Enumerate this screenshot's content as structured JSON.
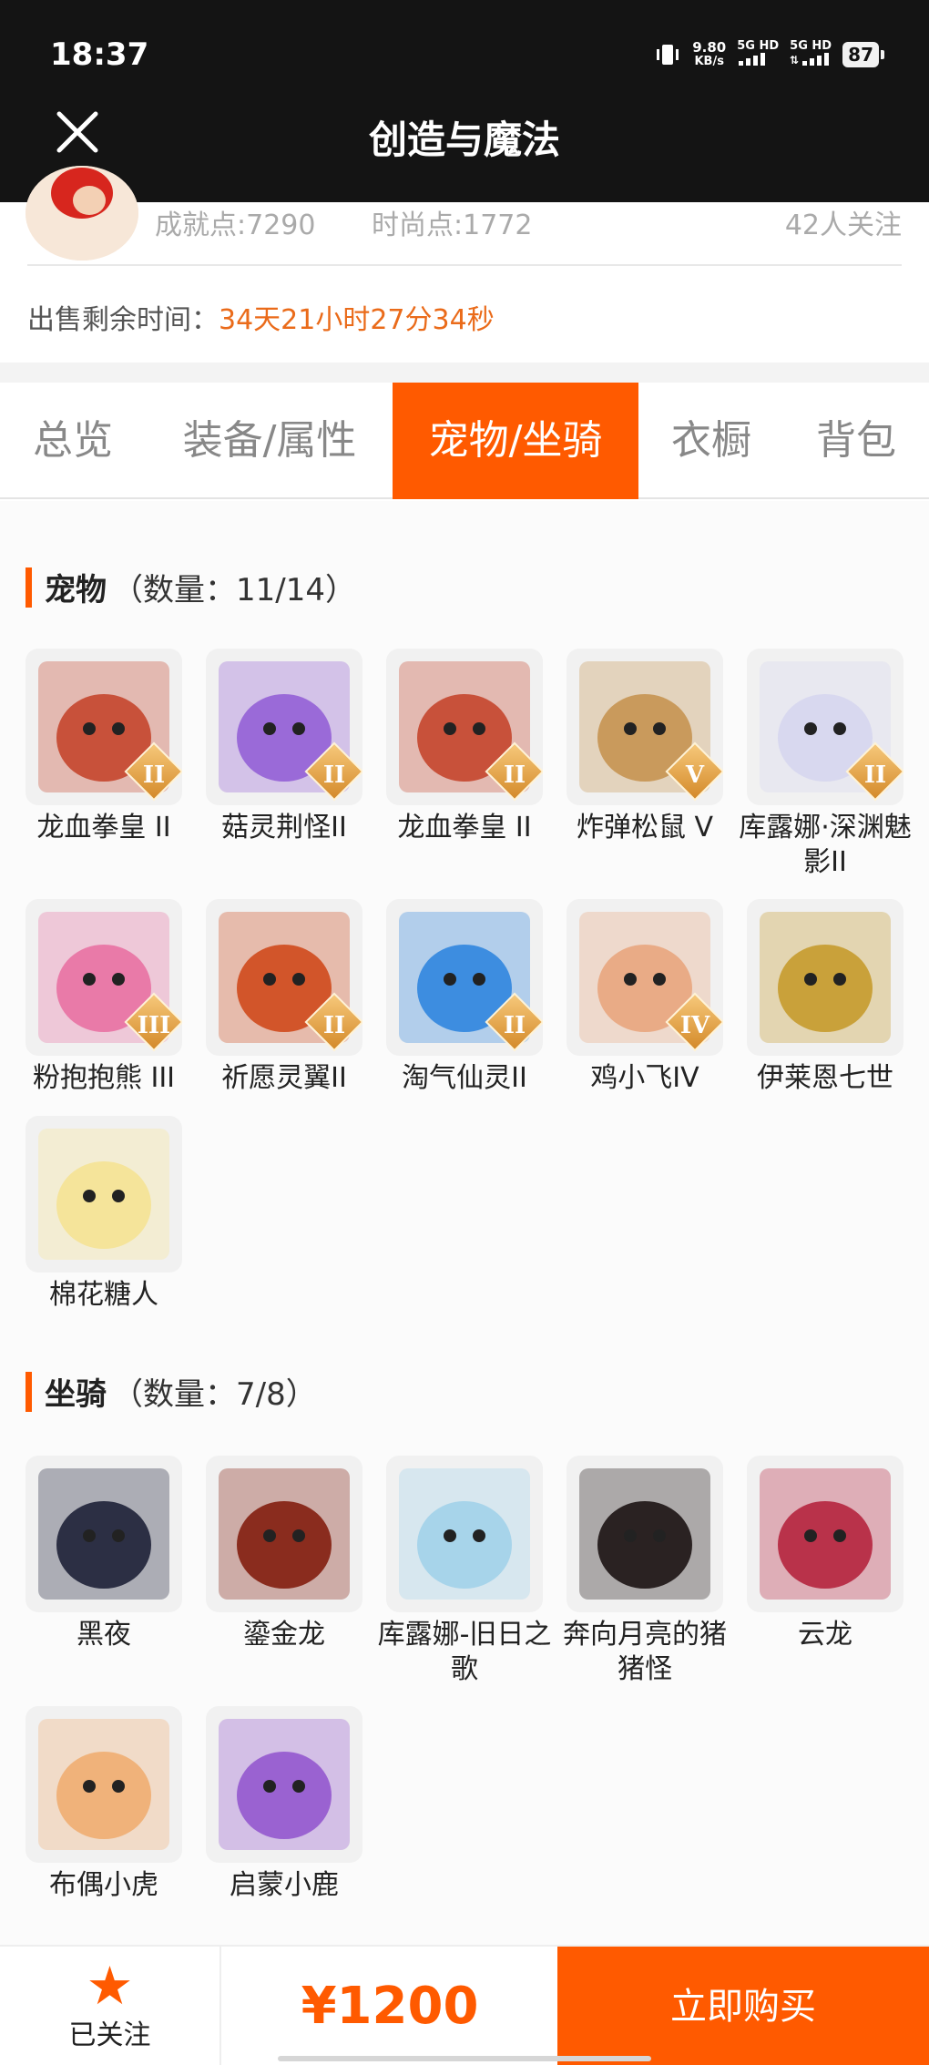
{
  "status_bar": {
    "time": "18:37",
    "net_speed_value": "9.80",
    "net_speed_unit": "KB/s",
    "sim1": "5G HD",
    "sim2": "5G HD",
    "battery": "87"
  },
  "header": {
    "title": "创造与魔法"
  },
  "seller": {
    "achievement": "成就点:7290",
    "fashion": "时尚点:1772",
    "followers": "42人关注"
  },
  "sale": {
    "label": "出售剩余时间：",
    "remaining": "34天21小时27分34秒"
  },
  "tabs": [
    {
      "label": "总览",
      "active": false
    },
    {
      "label": "装备/属性",
      "active": false
    },
    {
      "label": "宠物/坐骑",
      "active": true
    },
    {
      "label": "衣橱",
      "active": false
    },
    {
      "label": "背包",
      "active": false
    }
  ],
  "pets": {
    "title": "宠物",
    "count": "（数量：11/14）",
    "items": [
      {
        "name": "龙血拳皇 II",
        "badge": "II",
        "icon": "red-horned-beast-icon",
        "color": "#c8513a"
      },
      {
        "name": "菇灵荆怪II",
        "badge": "II",
        "icon": "purple-mushroom-sprite-icon",
        "color": "#9a6ad8"
      },
      {
        "name": "龙血拳皇 II",
        "badge": "II",
        "icon": "red-horned-beast-icon",
        "color": "#c8513a"
      },
      {
        "name": "炸弹松鼠 V",
        "badge": "V",
        "icon": "squirrel-icon",
        "color": "#c99a5c"
      },
      {
        "name": "库露娜·深渊魅影II",
        "badge": "II",
        "icon": "pale-siren-icon",
        "color": "#d8d8ef"
      },
      {
        "name": "粉抱抱熊 III",
        "badge": "III",
        "icon": "pink-bear-icon",
        "color": "#e97aa8"
      },
      {
        "name": "祈愿灵翼II",
        "badge": "II",
        "icon": "fire-bird-icon",
        "color": "#d2552a"
      },
      {
        "name": "淘气仙灵II",
        "badge": "II",
        "icon": "blue-pup-icon",
        "color": "#3d8de0"
      },
      {
        "name": "鸡小飞IV",
        "badge": "IV",
        "icon": "muscle-chick-icon",
        "color": "#e9ab86"
      },
      {
        "name": "伊莱恩七世",
        "badge": "",
        "icon": "golden-queen-icon",
        "color": "#c9a13a"
      },
      {
        "name": "棉花糖人",
        "badge": "",
        "icon": "cotton-candy-icon",
        "color": "#f5e49a"
      }
    ]
  },
  "mounts": {
    "title": "坐骑",
    "count": "（数量：7/8）",
    "items": [
      {
        "name": "黑夜",
        "icon": "black-dragon-icon",
        "color": "#2c2f44"
      },
      {
        "name": "鎏金龙",
        "icon": "gilded-dragon-icon",
        "color": "#8a2c1e"
      },
      {
        "name": "库露娜-旧日之歌",
        "icon": "cloud-sheep-girl-icon",
        "color": "#a7d4ea"
      },
      {
        "name": "奔向月亮的猪猪怪",
        "icon": "black-pig-icon",
        "color": "#2a2222"
      },
      {
        "name": "云龙",
        "icon": "cloud-dragon-icon",
        "color": "#b9324a"
      },
      {
        "name": "布偶小虎",
        "icon": "plush-tiger-icon",
        "color": "#f0b27a"
      },
      {
        "name": "启蒙小鹿",
        "icon": "white-deer-icon",
        "color": "#9a62d1"
      }
    ]
  },
  "footer": {
    "follow_label": "已关注",
    "price": "¥1200",
    "buy_label": "立即购买"
  }
}
